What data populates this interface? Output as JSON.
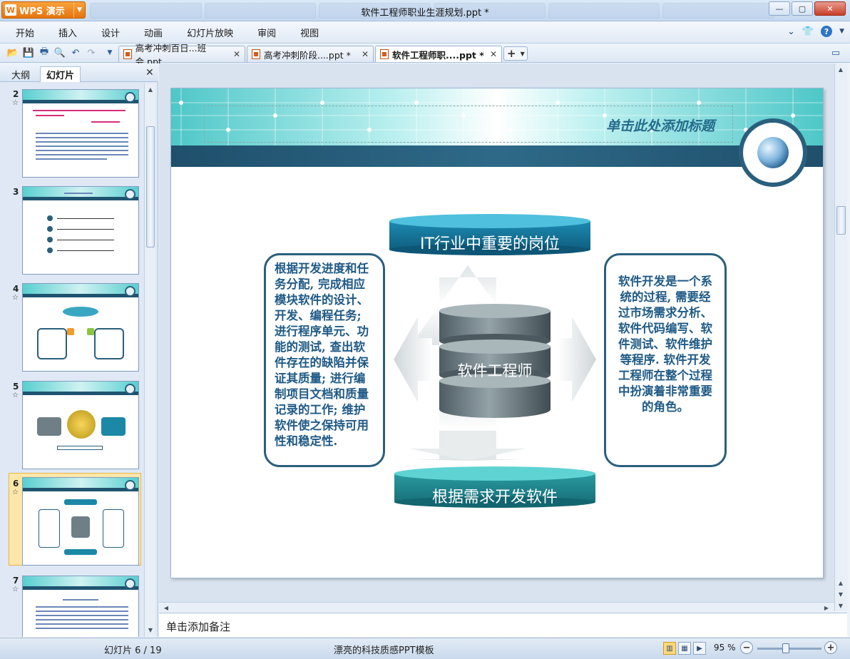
{
  "app": {
    "name": "WPS 演示",
    "window_title": "软件工程师职业生涯规划.ppt *"
  },
  "menu": [
    "开始",
    "插入",
    "设计",
    "动画",
    "幻灯片放映",
    "审阅",
    "视图"
  ],
  "doc_tabs": [
    {
      "label": "高考冲刺百日...班会.ppt",
      "active": false
    },
    {
      "label": "高考冲刺阶段....ppt *",
      "active": false
    },
    {
      "label": "软件工程师职....ppt *",
      "active": true
    }
  ],
  "left_panel": {
    "tab_outline": "大纲",
    "tab_slides": "幻灯片",
    "thumbs": [
      "2",
      "3",
      "4",
      "5",
      "6",
      "7"
    ],
    "selected": "6"
  },
  "slide": {
    "title": "单击此处添加标题",
    "top_label": "IT行业中重要的岗位",
    "center_label": "软件工程师",
    "bottom_label": "根据需求开发软件",
    "left_text": "根据开发进度和任务分配, 完成相应模块软件的设计、开发、编程任务; 进行程序单元、功能的测试, 查出软件存在的缺陷并保证其质量; 进行编制项目文档和质量记录的工作; 维护软件使之保持可用性和稳定性.",
    "right_text": "软件开发是一个系统的过程, 需要经过市场需求分析、软件代码编写、软件测试、软件维护等程序. 软件开发工程师在整个过程中扮演着非常重要的角色。"
  },
  "notes_placeholder": "单击添加备注",
  "status": {
    "slide_counter": "幻灯片 6 / 19",
    "template": "漂亮的科技质感PPT模板",
    "zoom": "95 %"
  },
  "colors": {
    "accent_teal": "#2a9fb0",
    "dark_blue": "#1f4f6b",
    "wps_orange": "#e6740e"
  }
}
